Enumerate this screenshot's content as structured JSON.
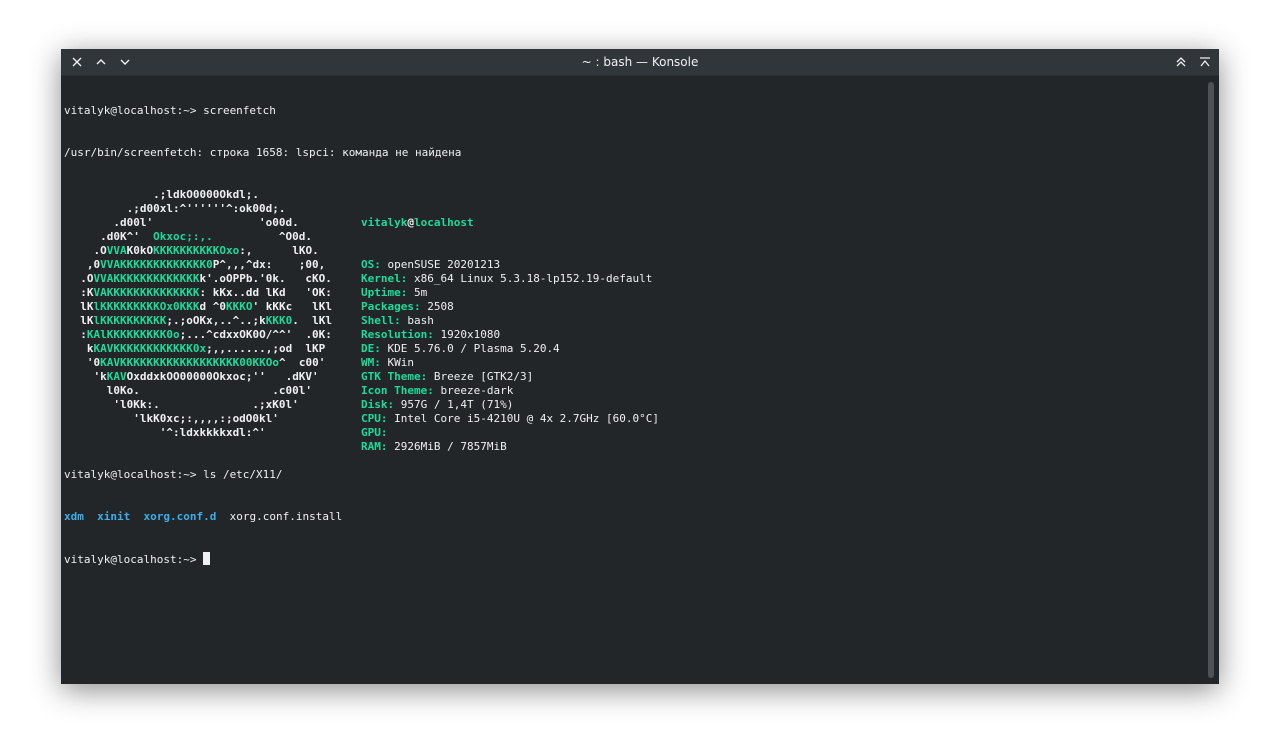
{
  "window": {
    "title": "~ : bash — Konsole"
  },
  "titlebar": {
    "left_icons": [
      "close-icon",
      "minimize-icon",
      "collapse-icon"
    ],
    "right_icons": [
      "keep-above-icon",
      "maximize-icon"
    ]
  },
  "terminal": {
    "prompt1": "vitalyk@localhost:~> screenfetch",
    "error": "/usr/bin/screenfetch: строка 1658: lspci: команда не найдена",
    "art": [
      "             .;ldkO0000Okdl;.",
      "         .;d00xl:^''''''^:ok00d;.",
      "       .d00l'                'o00d.",
      "     .d0K^'  Okxoc;:,.          ^O0d.",
      "    .OVVAK0kOKKKKKKKKKKOxo:,      lKO.",
      "   ,0VVAKKKKKKKKKKKKK0P^,,,^dx:    ;00,",
      "  .OVVAKKKKKKKKKKKKKk'.oOPPb.'0k.   cKO.",
      "  :KVAKKKKKKKKKKKKKK: kKx..dd lKd   'OK:",
      "  lKlKKKKKKKKKOx0KKKd ^0KKKO' kKKc   lKl",
      "  lKlKKKKKKKKKK;.;oOKx,..^..;kKKK0.  lKl",
      "  :KAlKKKKKKKKK0o;...^cdxxOK0O/^^'  .0K:",
      "   kKAVKKKKKKKKKKKK0x;,,......,;od  lKP",
      "   '0KAVKKKKKKKKKKKKKKKKKK00KKOo^  c00'",
      "    'kKAVOxddxkOO00000Okxoc;''   .dKV'",
      "      l0Ko.                    .c00l'",
      "       'l0Kk:.              .;xK0l'",
      "          'lkK0xc;:,,,,:;odO0kl'",
      "              '^:ldxkkkkxdl:^'"
    ],
    "info": {
      "user": "vitalyk",
      "at": "@",
      "host": "localhost",
      "rows": [
        {
          "key": "OS:",
          "value": " openSUSE 20201213"
        },
        {
          "key": "Kernel:",
          "value": " x86_64 Linux 5.3.18-lp152.19-default"
        },
        {
          "key": "Uptime:",
          "value": " 5m"
        },
        {
          "key": "Packages:",
          "value": " 2508"
        },
        {
          "key": "Shell:",
          "value": " bash"
        },
        {
          "key": "Resolution:",
          "value": " 1920x1080"
        },
        {
          "key": "DE:",
          "value": " KDE 5.76.0 / Plasma 5.20.4"
        },
        {
          "key": "WM:",
          "value": " KWin"
        },
        {
          "key": "GTK Theme:",
          "value": " Breeze [GTK2/3]"
        },
        {
          "key": "Icon Theme:",
          "value": " breeze-dark"
        },
        {
          "key": "Disk:",
          "value": " 957G / 1,4T (71%)"
        },
        {
          "key": "CPU:",
          "value": " Intel Core i5-4210U @ 4x 2.7GHz [60.0°C]"
        },
        {
          "key": "GPU:",
          "value": ""
        },
        {
          "key": "RAM:",
          "value": " 2926MiB / 7857MiB"
        }
      ]
    },
    "prompt2": "vitalyk@localhost:~> ls /etc/X11/",
    "ls": {
      "xdm": "xdm",
      "xinit": "xinit",
      "xorgconfd": "xorg.conf.d",
      "xorgconfinstall": "xorg.conf.install"
    },
    "prompt3": "vitalyk@localhost:~> "
  },
  "colors": {
    "accent": "#1cdc9a",
    "directory": "#3daee9",
    "background": "#232629",
    "foreground": "#eff0f1"
  }
}
